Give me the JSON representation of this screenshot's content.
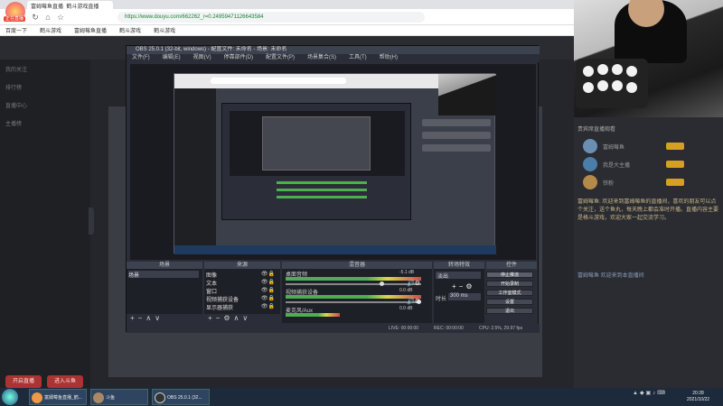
{
  "browser": {
    "tab_title": "富姆莓鱼直播_鹤斗游戏直播",
    "address": "https://www.douyu.com/662262_r=0.24959471126643584",
    "bookmarks": [
      "百度一下",
      "鹤斗游戏",
      "富姆莓鱼直播",
      "鹤斗游戏",
      "鹤斗游戏"
    ]
  },
  "douyu": {
    "logo_badge": "正在直播",
    "sidebar_labels": [
      "我的关注",
      "排行榜",
      "直播中心",
      "主播榜"
    ],
    "sidebar_buttons": [
      "开启直播",
      "进入斗鱼"
    ]
  },
  "right_panel": {
    "title": "贵宾席直播观看",
    "users": [
      "富姆莓鱼",
      "我是大主播",
      "铁粉"
    ],
    "chat_text": "富姆莓鱼: 欢迎来到富姆莓鱼的直播间，喜欢的朋友可以点个关注，送个鱼丸，每天晚上都会准时开播。直播内容主要是格斗游戏，欢迎大家一起交流学习。",
    "footer_text": "富姆莓鱼 欢迎来到本直播间"
  },
  "obs": {
    "title": "OBS 25.0.1 (32-bit, windows) - 配置文件: 未命名 - 场景: 未命名",
    "menu": [
      "文件(F)",
      "编辑(E)",
      "视图(V)",
      "停靠部件(D)",
      "配置文件(P)",
      "场景集合(S)",
      "工具(T)",
      "帮助(H)"
    ],
    "docks": {
      "scenes": "场景",
      "sources": "来源",
      "mixer": "混音器",
      "transitions": "转场特效",
      "controls": "控件"
    },
    "scenes_list": [
      "场景"
    ],
    "sources_list": [
      "图像",
      "文本",
      "窗口",
      "视频捕获设备",
      "显示器捕获"
    ],
    "mixer_channels": [
      {
        "name": "桌面音频",
        "db": "-5.1 dB"
      },
      {
        "name": "视频捕获设备",
        "db": "0.0 dB"
      },
      {
        "name": "麦克风/Aux",
        "db": "0.0 dB"
      }
    ],
    "transition": {
      "type": "淡出",
      "duration_label": "时长",
      "duration": "300 ms"
    },
    "controls": [
      "停止推流",
      "开始录制",
      "工作室模式",
      "设置",
      "退出"
    ],
    "status": {
      "live": "LIVE: 00:00:00",
      "rec": "REC: 00:00:00",
      "cpu": "CPU: 2.5%, 29.97 fps"
    }
  },
  "taskbar": {
    "tasks": [
      "富姆莓鱼直播_鹤...",
      "斗鱼",
      "OBS 25.0.1 (32..."
    ],
    "time": "20:28",
    "date": "2021/10/22"
  }
}
